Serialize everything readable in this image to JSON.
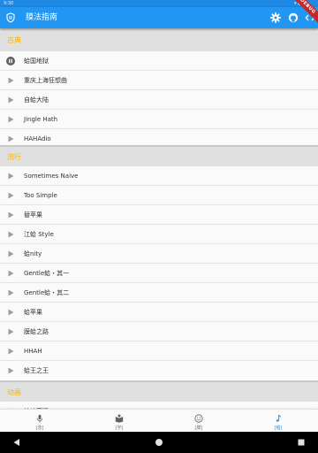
{
  "status_bar": {
    "time": "9:30",
    "debug_label": "DEBUG"
  },
  "app_bar": {
    "title": "膜法指南"
  },
  "sections": [
    {
      "title": "古典",
      "items": [
        {
          "label": "蛤国地狱",
          "icon": "pause-circle-icon"
        },
        {
          "label": "重庆上海狂想曲",
          "icon": "play-icon"
        },
        {
          "label": "自蛤大陆",
          "icon": "play-icon"
        },
        {
          "label": "Jingle Hath",
          "icon": "play-icon"
        },
        {
          "label": "HAHAdio",
          "icon": "play-icon"
        }
      ]
    },
    {
      "title": "流行",
      "items": [
        {
          "label": "Sometimes Naive",
          "icon": "play-icon"
        },
        {
          "label": "Too Simple",
          "icon": "play-icon"
        },
        {
          "label": "替苹果",
          "icon": "play-icon"
        },
        {
          "label": "江蛤 Style",
          "icon": "play-icon"
        },
        {
          "label": "蛤nity",
          "icon": "play-icon"
        },
        {
          "label": "Gentle蛤・其一",
          "icon": "play-icon"
        },
        {
          "label": "Gentle蛤・其二",
          "icon": "play-icon"
        },
        {
          "label": "蛤苹果",
          "icon": "play-icon"
        },
        {
          "label": "膜蛤之路",
          "icon": "play-icon"
        },
        {
          "label": "HHAH",
          "icon": "play-icon"
        },
        {
          "label": "蛤王之王",
          "icon": "play-icon"
        }
      ]
    },
    {
      "title": "动画",
      "items": [
        {
          "label": "蛤蛤蓄嗯",
          "icon": "play-icon"
        }
      ]
    }
  ],
  "bottom_nav": [
    {
      "label": "[念]",
      "icon": "mic-icon",
      "active": false
    },
    {
      "label": "[学]",
      "icon": "book-icon",
      "active": false
    },
    {
      "label": "[膜]",
      "icon": "smile-icon",
      "active": false
    },
    {
      "label": "[唱]",
      "icon": "music-note-icon",
      "active": true
    }
  ],
  "colors": {
    "primary": "#2196f3",
    "section_title": "#ffb300",
    "active_nav": "#2196f3"
  }
}
